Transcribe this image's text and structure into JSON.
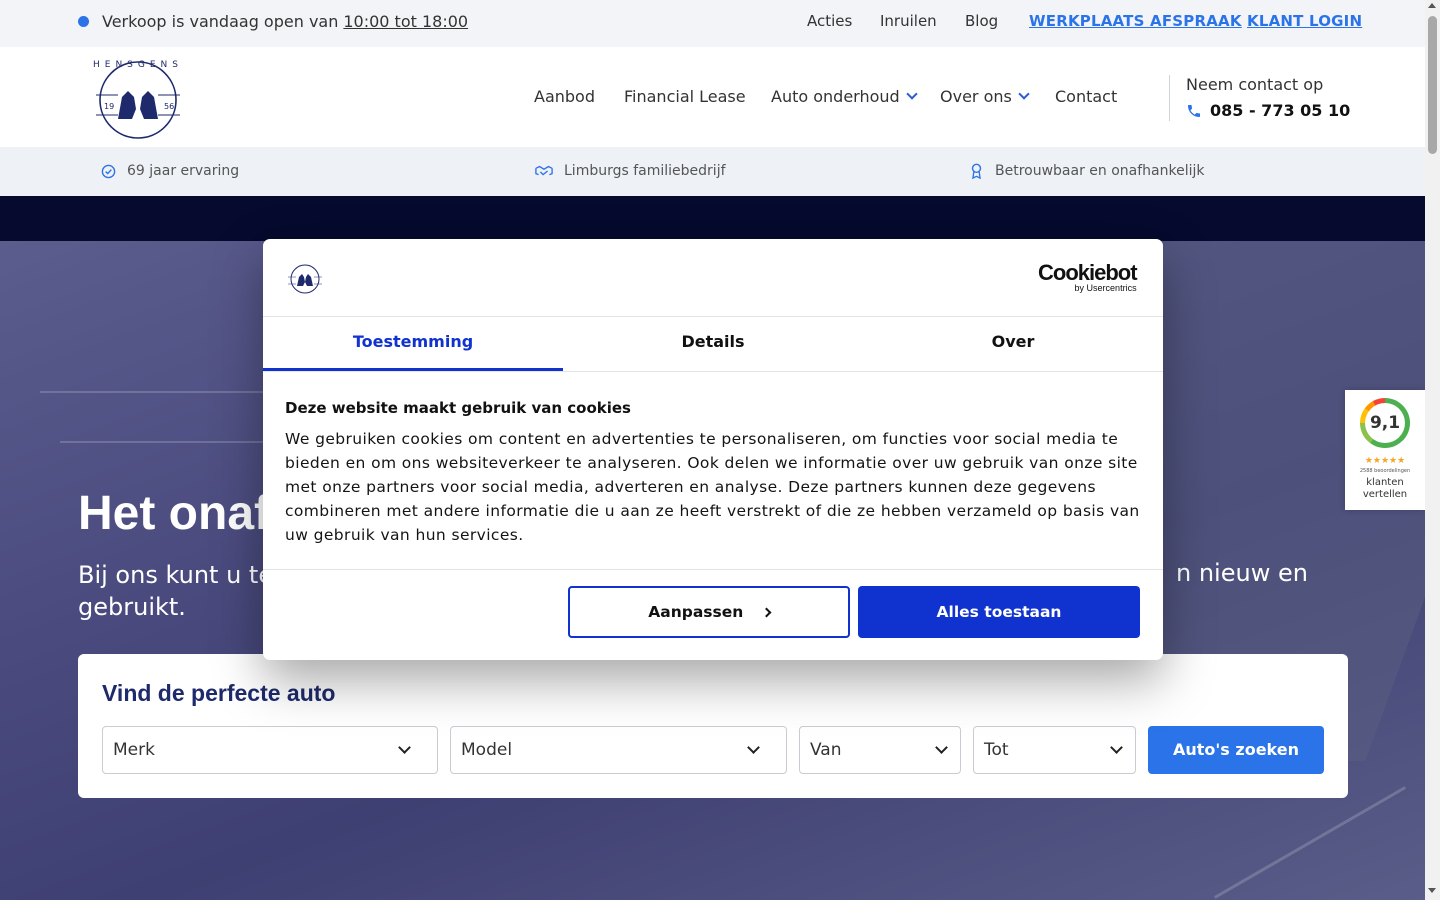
{
  "topbar": {
    "open_text": "Verkoop is vandaag open van",
    "open_hours": "10:00 tot 18:00",
    "links": [
      "Acties",
      "Inruilen",
      "Blog"
    ],
    "workshop_link": "WERKPLAATS AFSPRAAK",
    "login_link": "KLANT LOGIN"
  },
  "header": {
    "logo_text": "HENSGENS",
    "logo_year_left": "19",
    "logo_year_right": "56",
    "nav": {
      "aanbod": "Aanbod",
      "lease": "Financial Lease",
      "onderhoud": "Auto onderhoud",
      "over": "Over ons",
      "contact": "Contact"
    },
    "contact_label": "Neem contact op",
    "phone": "085 - 773 05 10"
  },
  "usp": [
    "69 jaar ervaring",
    "Limburgs familiebedrijf",
    "Betrouwbaar en onafhankelijk"
  ],
  "hero": {
    "title": "Het onaf",
    "subtitle_left": "Bij ons kunt u te",
    "subtitle_right": "n nieuw en",
    "subtitle_line2": "gebruikt."
  },
  "search": {
    "title": "Vind de perfecte auto",
    "merk": "Merk",
    "model": "Model",
    "van": "Van",
    "tot": "Tot",
    "button": "Auto's zoeken"
  },
  "rating": {
    "score": "9,1",
    "stars": "★★★★★",
    "count": "2588 beoordelingen",
    "label": "klanten vertellen"
  },
  "cookie": {
    "brand": "Cookiebot",
    "brand_sub": "by Usercentrics",
    "tabs": {
      "consent": "Toestemming",
      "details": "Details",
      "about": "Over"
    },
    "title": "Deze website maakt gebruik van cookies",
    "body": "We gebruiken cookies om content en advertenties te personaliseren, om functies voor social media te bieden en om ons websiteverkeer te analyseren. Ook delen we informatie over uw gebruik van onze site met onze partners voor social media, adverteren en analyse. Deze partners kunnen deze gegevens combineren met andere informatie die u aan ze heeft verstrekt of die ze hebben verzameld op basis van uw gebruik van hun services.",
    "customize_button": "Aanpassen",
    "accept_button": "Alles toestaan"
  },
  "colors": {
    "accent": "#2a73e8",
    "cookie_blue": "#1032cf",
    "navy": "#1e2a6b"
  },
  "icons": {
    "phone": "phone-icon",
    "usp1": "check-circle-icon",
    "usp2": "handshake-icon",
    "usp3": "award-icon"
  }
}
